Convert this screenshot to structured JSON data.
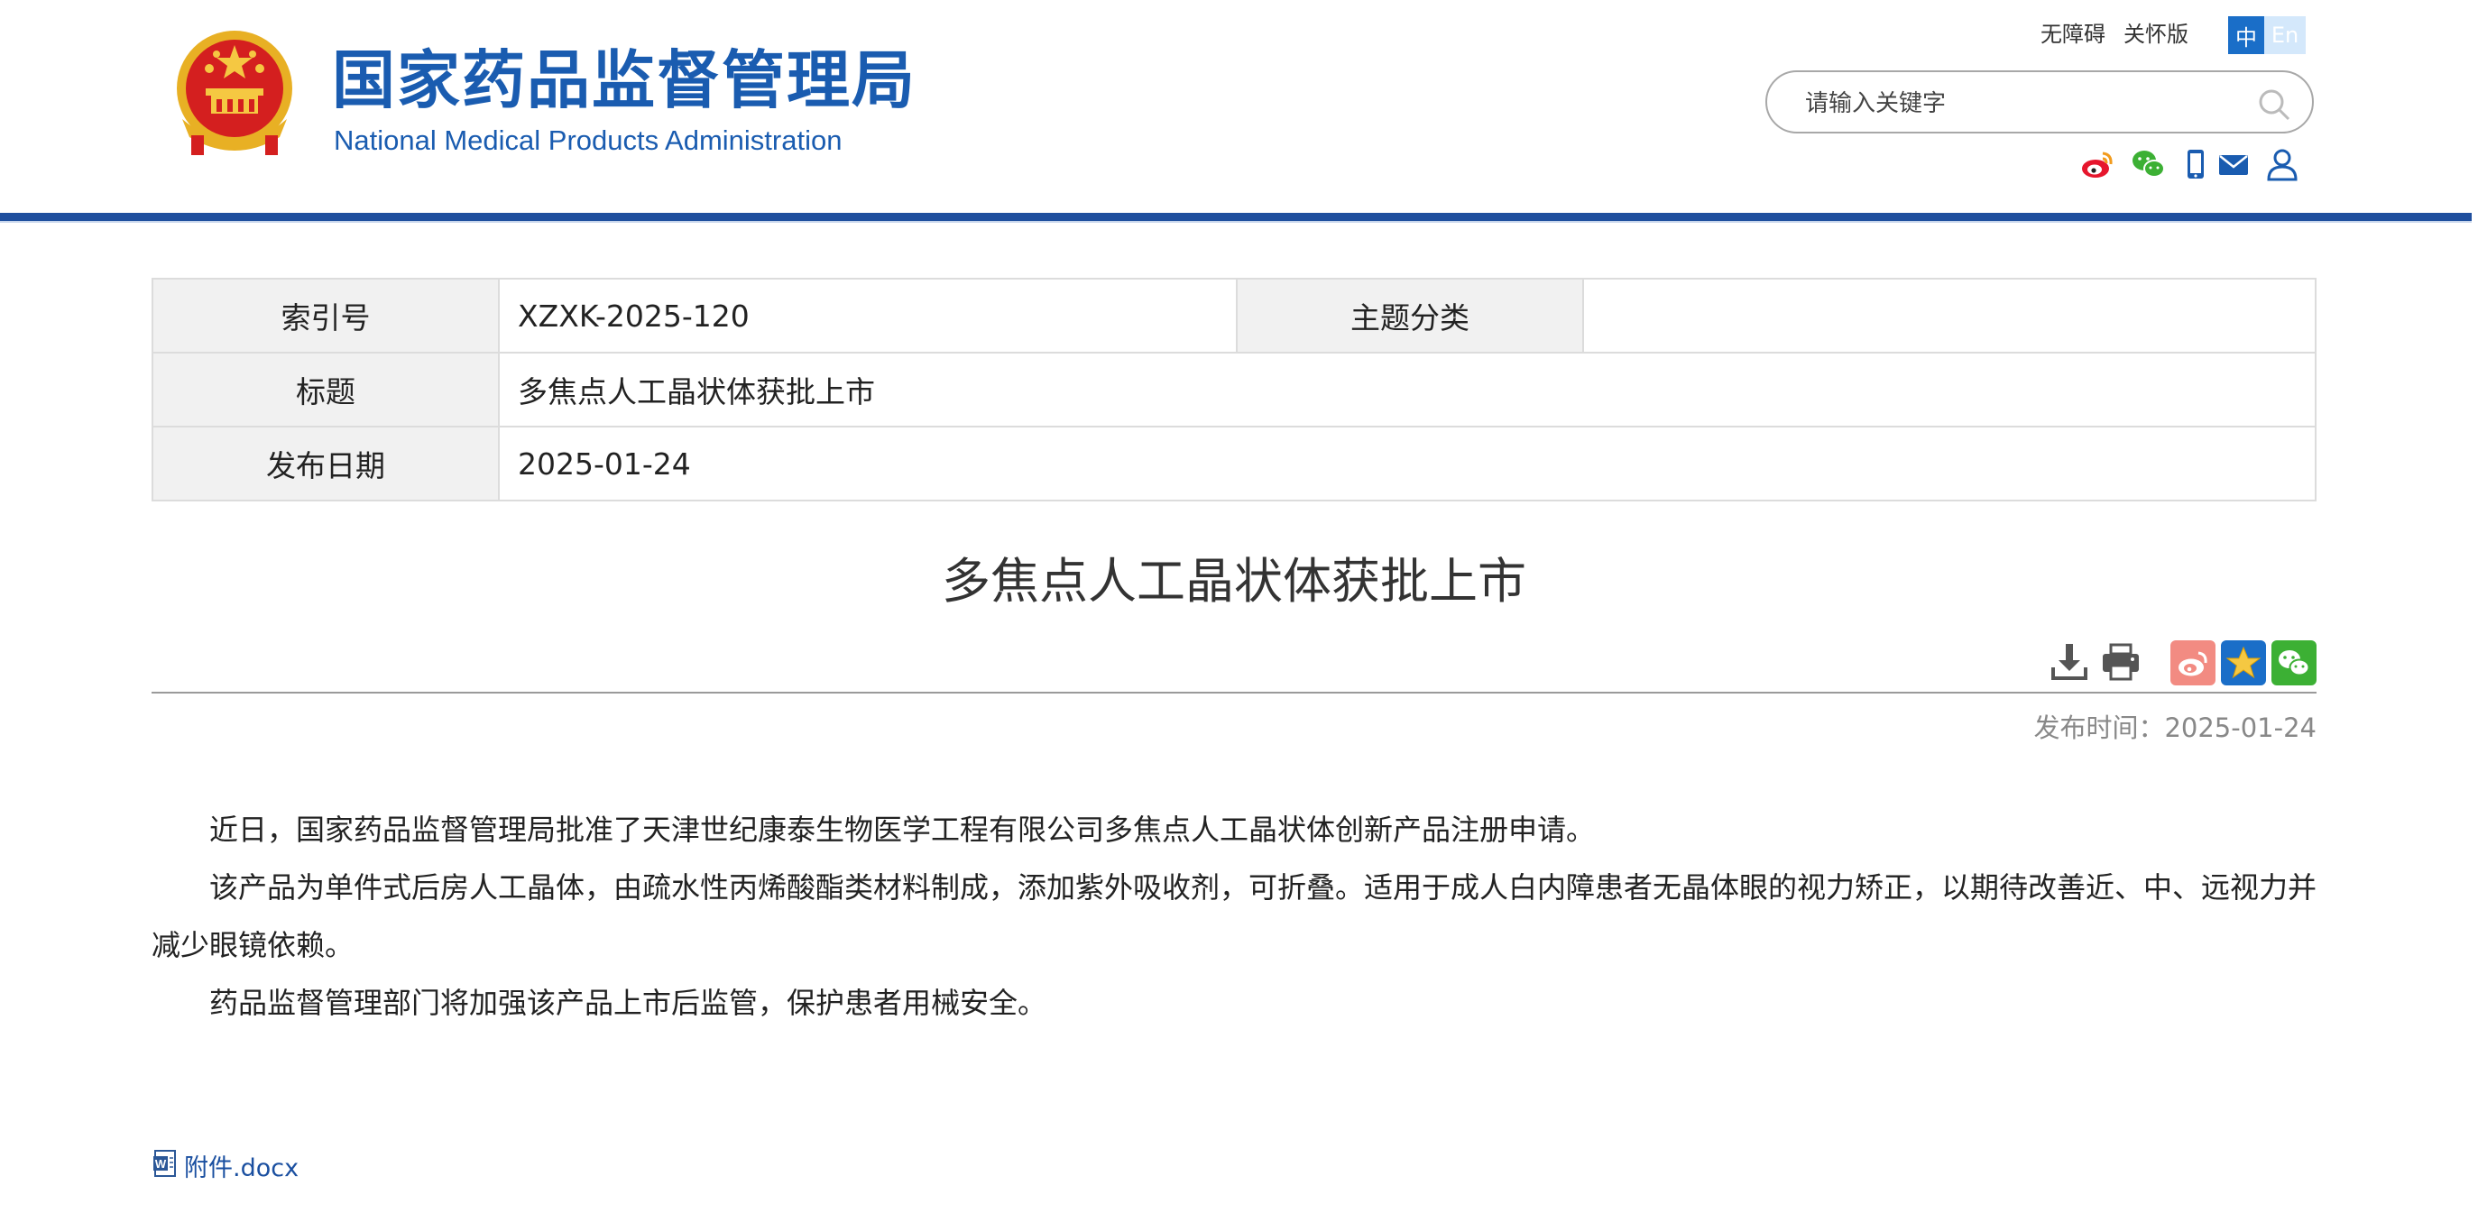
{
  "header": {
    "site_name_cn": "国家药品监督管理局",
    "site_name_en": "National Medical Products Administration",
    "links": {
      "accessibility": "无障碍",
      "elderly": "关怀版",
      "lang_zh": "中",
      "lang_en": "En"
    },
    "search": {
      "placeholder": "请输入关键字"
    },
    "social_icons": [
      "weibo-icon",
      "wechat-icon",
      "mobile-icon",
      "mail-icon",
      "user-icon"
    ]
  },
  "info": {
    "index_label": "索引号",
    "index_value": "XZXK-2025-120",
    "topic_label": "主题分类",
    "topic_value": "",
    "title_label": "标题",
    "title_value": "多焦点人工晶状体获批上市",
    "date_label": "发布日期",
    "date_value": "2025-01-24"
  },
  "article": {
    "title": "多焦点人工晶状体获批上市",
    "pub_time": "发布时间：2025-01-24",
    "paragraphs": [
      "近日，国家药品监督管理局批准了天津世纪康泰生物医学工程有限公司多焦点人工晶状体创新产品注册申请。",
      "该产品为单件式后房人工晶体，由疏水性丙烯酸酯类材料制成，添加紫外吸收剂，可折叠。适用于成人白内障患者无晶体眼的视力矫正，以期待改善近、中、远视力并减少眼镜依赖。",
      "药品监督管理部门将加强该产品上市后监管，保护患者用械安全。"
    ],
    "attachment": "附件.docx"
  },
  "colors": {
    "brand_blue": "#1a5cb0",
    "header_bar": "#1f4f9e",
    "lang_active": "#1a6ec8",
    "weibo_share": "#f28b82",
    "favorite_share": "#1a6ec8",
    "wechat_share": "#3cb034"
  }
}
